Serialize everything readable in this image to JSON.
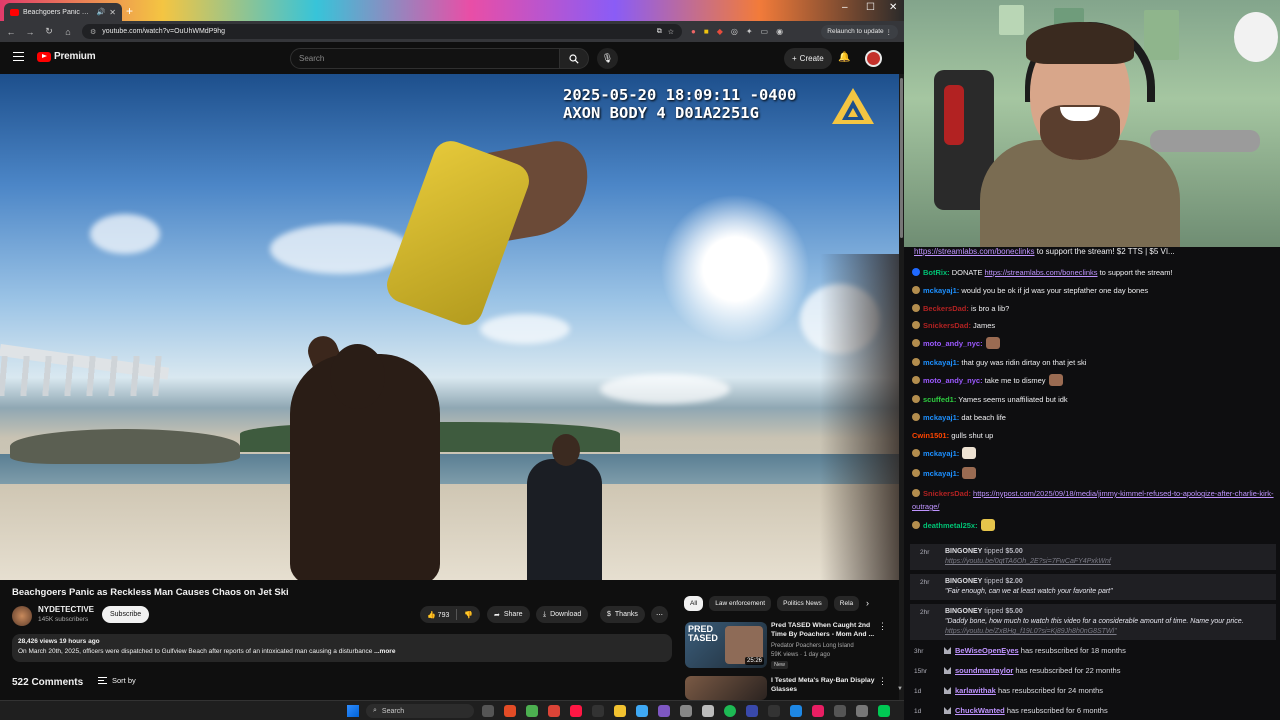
{
  "browser": {
    "tab_title": "Beachgoers Panic as Reckle...",
    "url": "youtube.com/watch?v=OuUhWMdP9hg",
    "relaunch_label": "Relaunch to update"
  },
  "yt_header": {
    "logo_text": "Premium",
    "search_placeholder": "Search",
    "create_label": "Create"
  },
  "video": {
    "overlay_line1": "2025-05-20 18:09:11 -0400",
    "overlay_line2": "AXON BODY 4 D01A2251G",
    "title": "Beachgoers Panic as Reckless Man Causes Chaos on Jet Ski",
    "channel": "NYDETECTIVE",
    "subscribers": "145K subscribers",
    "subscribe_label": "Subscribe",
    "likes": "793",
    "share_label": "Share",
    "download_label": "Download",
    "thanks_label": "Thanks",
    "desc_meta": "28,426 views  19 hours ago",
    "desc_text": "On March 20th, 2025, officers were dispatched to Gulfview Beach after reports of an intoxicated man causing a disturbance",
    "desc_more": "...more",
    "comments_count": "522 Comments",
    "sort_label": "Sort by"
  },
  "related": {
    "chips": [
      "All",
      "Law enforcement",
      "Politics News",
      "Rela"
    ],
    "items": [
      {
        "title": "Pred TASED When Caught 2nd Time By Poachers - Mom And ...",
        "channel": "Predator Poachers Long Island",
        "meta": "59K views · 1 day ago",
        "badge": "New",
        "duration": "25:26",
        "thumb_text": "PRED TASED"
      },
      {
        "title": "I Tested Meta's Ray-Ban Display Glasses",
        "channel": "",
        "meta": "",
        "badge": "",
        "duration": "",
        "thumb_text": ""
      }
    ]
  },
  "chat": {
    "ticker_link": "https://streamlabs.com/boneclinks",
    "ticker_text": " to support the stream! $2 TTS | $5 VI...",
    "messages": [
      {
        "user": "BotRix:",
        "user_color": "#00c274",
        "text_before": " DONATE ",
        "link": "https://streamlabs.com/boneclinks",
        "text_after": " to support the stream!",
        "badge": "bot"
      },
      {
        "user": "mckayaj1:",
        "user_color": "#1e90ff",
        "text_before": " would you be ok if jd was your stepfather one day bones",
        "link": "",
        "text_after": "",
        "badge": "sub"
      },
      {
        "user": "BeckersDad:",
        "user_color": "#b22222",
        "text_before": " is bro a lib?",
        "link": "",
        "text_after": "",
        "badge": "sub"
      },
      {
        "user": "SnickersDad:",
        "user_color": "#b22222",
        "text_before": " James",
        "link": "",
        "text_after": "",
        "badge": "sub"
      },
      {
        "user": "moto_andy_nyc:",
        "user_color": "#9b59ff",
        "text_before": "",
        "link": "",
        "text_after": "",
        "badge": "sub",
        "emote": "face"
      },
      {
        "user": "mckayaj1:",
        "user_color": "#1e90ff",
        "text_before": " that guy was ridin dirtay on that jet ski",
        "link": "",
        "text_after": "",
        "badge": "sub"
      },
      {
        "user": "moto_andy_nyc:",
        "user_color": "#9b59ff",
        "text_before": " take me to dismey",
        "link": "",
        "text_after": "",
        "badge": "sub",
        "emote": "face"
      },
      {
        "user": "scuffed1:",
        "user_color": "#2ecc40",
        "text_before": " Yames seems unaffiliated but idk",
        "link": "",
        "text_after": "",
        "badge": "sub"
      },
      {
        "user": "mckayaj1:",
        "user_color": "#1e90ff",
        "text_before": " dat beach life",
        "link": "",
        "text_after": "",
        "badge": "sub"
      },
      {
        "user": "Cwin1501:",
        "user_color": "#ff4500",
        "text_before": " gulls shut up",
        "link": "",
        "text_after": "",
        "badge": ""
      },
      {
        "user": "mckayaj1:",
        "user_color": "#1e90ff",
        "text_before": "",
        "link": "",
        "text_after": "",
        "badge": "sub",
        "emote": "light"
      },
      {
        "user": "mckayaj1:",
        "user_color": "#1e90ff",
        "text_before": "",
        "link": "",
        "text_after": "",
        "badge": "sub",
        "emote": "face"
      },
      {
        "user": "SnickersDad:",
        "user_color": "#b22222",
        "text_before": " ",
        "link": "https://nypost.com/2025/09/18/media/jimmy-kimmel-refused-to-apologize-after-charlie-kirk-outrage/",
        "text_after": "",
        "badge": "sub"
      },
      {
        "user": "deathmetal25x:",
        "user_color": "#00c274",
        "text_before": "",
        "link": "",
        "text_after": "",
        "badge": "sub",
        "emote": "gold"
      }
    ],
    "tips": [
      {
        "time": "2hr",
        "user": "BINGONEY",
        "action": " tipped ",
        "amount": "$5.00",
        "message": "",
        "link": "https://youtu.be/0qtTA6Oh_2E?si=7FwCaFY4PxkWnf"
      },
      {
        "time": "2hr",
        "user": "BINGONEY",
        "action": " tipped ",
        "amount": "$2.00",
        "message": "\"Fair enough, can we at least watch your favorite part\"",
        "link": ""
      },
      {
        "time": "2hr",
        "user": "BINGONEY",
        "action": " tipped ",
        "amount": "$5.00",
        "message": "\"Daddy bone, how much to watch this video for a considerable amount of time. Name your price.",
        "link": "https://youtu.be/ZxBHg_f19L0?si=Kj89Jh8h0nG8STWl\""
      }
    ],
    "subs": [
      {
        "time": "3hr",
        "user": "BeWiseOpenEyes",
        "text": " has resubscribed for 18 months"
      },
      {
        "time": "15hr",
        "user": "soundmantaylor",
        "text": " has resubscribed for 22 months"
      },
      {
        "time": "1d",
        "user": "karlawithak",
        "text": " has resubscribed for 24 months"
      },
      {
        "time": "1d",
        "user": "ChuckWanted",
        "text": " has resubscribed for 6 months"
      }
    ]
  },
  "taskbar": {
    "search_label": "Search"
  },
  "colors": {
    "yt_red": "#ff0000",
    "twitch_purple": "#bf94ff",
    "bg_dark": "#0f0f0f"
  }
}
